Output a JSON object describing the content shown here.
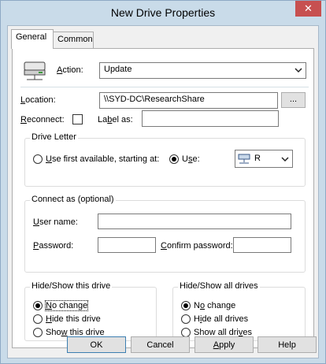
{
  "window": {
    "title": "New Drive Properties",
    "close_glyph": "✕"
  },
  "tabs": [
    {
      "label": "General",
      "active": true
    },
    {
      "label": "Common",
      "active": false
    }
  ],
  "action": {
    "label": "Action:",
    "value": "Update",
    "icon": "drive-network-icon"
  },
  "location": {
    "label": "Location:",
    "value": "\\\\SYD-DC\\ResearchShare",
    "browse_label": "..."
  },
  "reconnect": {
    "label": "Reconnect:",
    "checked": false
  },
  "label_as": {
    "label": "Label as:",
    "value": ""
  },
  "drive_letter": {
    "group_title": "Drive Letter",
    "first_available_label": "Use first available, starting at:",
    "use_label": "Use:",
    "selected_option": "use",
    "use_value": "R",
    "drive_icon": "network-drive-icon"
  },
  "connect_as": {
    "group_title": "Connect as (optional)",
    "username_label": "User name:",
    "username_value": "",
    "password_label": "Password:",
    "password_value": "",
    "confirm_label": "Confirm password:",
    "confirm_value": ""
  },
  "hide_show_drive": {
    "group_title": "Hide/Show this drive",
    "options": [
      "No change",
      "Hide this drive",
      "Show this drive"
    ],
    "selected": "No change"
  },
  "hide_show_all": {
    "group_title": "Hide/Show all drives",
    "options": [
      "No change",
      "Hide all drives",
      "Show all drives"
    ],
    "selected": "No change"
  },
  "buttons": {
    "ok": "OK",
    "cancel": "Cancel",
    "apply": "Apply",
    "help": "Help"
  },
  "colors": {
    "title_bg": "#c9dbe9",
    "close_bg": "#c75050",
    "panel_bg": "#ffffff",
    "dialog_bg": "#f0f0f0"
  }
}
